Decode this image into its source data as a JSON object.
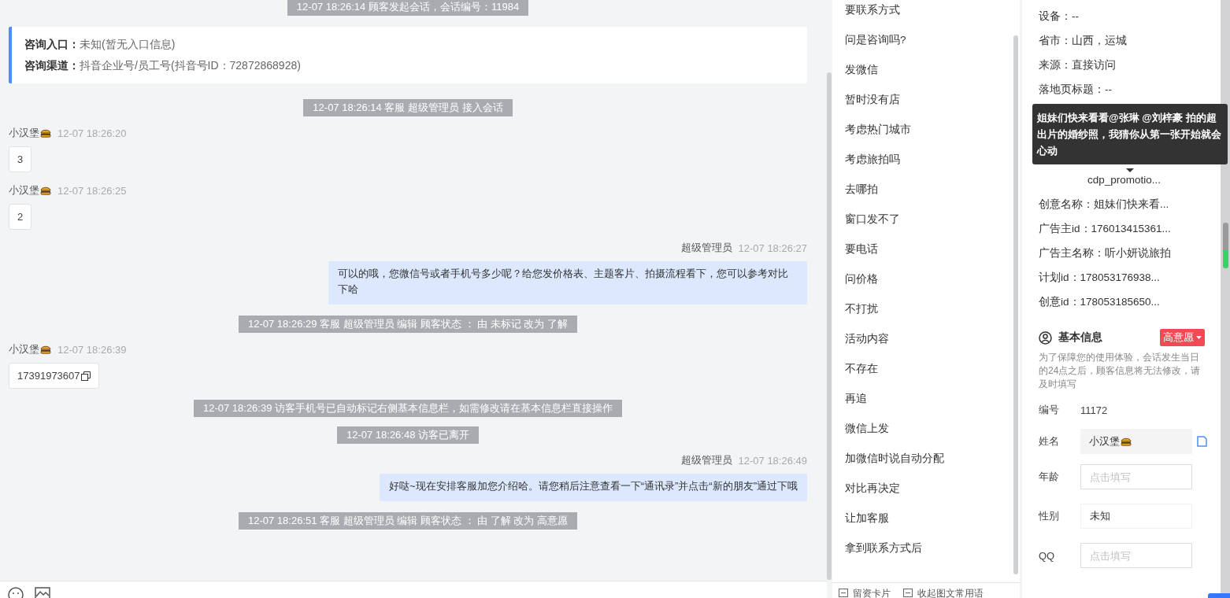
{
  "chat": {
    "messages": [
      {
        "kind": "system",
        "text": "12-07 18:26:14 顾客发起会话，会话编号：11984"
      },
      {
        "kind": "entry",
        "lines": [
          {
            "label": "咨询入口：",
            "value": "未知(暂无入口信息)"
          },
          {
            "label": "咨询渠道：",
            "value": "抖音企业号/员工号(抖音号ID：72872868928)"
          }
        ]
      },
      {
        "kind": "system",
        "text": "12-07 18:26:14 客服 超级管理员 接入会话"
      },
      {
        "kind": "visitor",
        "name": "小汉堡",
        "time": "12-07 18:26:20",
        "text": "3",
        "copyable": false
      },
      {
        "kind": "visitor",
        "name": "小汉堡",
        "time": "12-07 18:26:25",
        "text": "2",
        "copyable": false
      },
      {
        "kind": "agent",
        "name": "超级管理员",
        "time": "12-07 18:26:27",
        "text": "可以的哦，您微信号或者手机号多少呢？给您发价格表、主题客片、拍摄流程看下，您可以参考对比下哈"
      },
      {
        "kind": "system",
        "text": "12-07 18:26:29 客服 超级管理员 编辑 顾客状态 ： 由 未标记 改为 了解"
      },
      {
        "kind": "visitor",
        "name": "小汉堡",
        "time": "12-07 18:26:39",
        "text": "17391973607",
        "copyable": true
      },
      {
        "kind": "system",
        "text": "12-07 18:26:39 访客手机号已自动标记右侧基本信息栏，如需修改请在基本信息栏直接操作"
      },
      {
        "kind": "system",
        "text": "12-07 18:26:48 访客已离开"
      },
      {
        "kind": "agent",
        "name": "超级管理员",
        "time": "12-07 18:26:49",
        "text": "好哒~现在安排客服加您介绍哈。请您稍后注意查看一下“通讯录”并点击“新的朋友”通过下哦"
      },
      {
        "kind": "system",
        "text": "12-07 18:26:51 客服 超级管理员 编辑 顾客状态 ： 由 了解 改为 高意愿"
      }
    ]
  },
  "quick_replies": {
    "items": [
      "要联系方式",
      "问是咨询吗?",
      "发微信",
      "暂时没有店",
      "考虑热门城市",
      "考虑旅拍吗",
      "去哪拍",
      "窗口发不了",
      "要电话",
      "问价格",
      "不打扰",
      "活动内容",
      "不存在",
      "再追",
      "微信上发",
      "加微信时说自动分配",
      "对比再决定",
      "让加客服",
      "拿到联系方式后"
    ],
    "footer": [
      "留资卡片",
      "收起图文常用语"
    ]
  },
  "visitor_info": {
    "rows": [
      "设备：--",
      "省市：山西，运城",
      "来源：直接访问",
      "落地页标题：--",
      "cdp_promotio...",
      "创意名称：姐妹们快来看...",
      "广告主id：176013415361...",
      "广告主名称：听小妍说旅拍",
      "计划id：178053176938...",
      "创意id：178053185650..."
    ],
    "tooltip": "姐妹们快来看看@张琳 @刘梓豪 拍的超出片的婚纱照，我猜你从第一张开始就会心动"
  },
  "basic_info": {
    "title": "基本信息",
    "status": "高意愿",
    "notice": "为了保障您的使用体验，会话发生当日的24点之后，顾客信息将无法修改，请及时填写",
    "fields": [
      {
        "kind": "text",
        "label": "编号",
        "value": "11172"
      },
      {
        "kind": "name",
        "label": "姓名",
        "value": "小汉堡"
      },
      {
        "kind": "input",
        "label": "年龄",
        "placeholder": "点击填写"
      },
      {
        "kind": "input",
        "label": "性别",
        "value": "未知"
      },
      {
        "kind": "input",
        "label": "QQ",
        "placeholder": "点击填写"
      }
    ]
  }
}
